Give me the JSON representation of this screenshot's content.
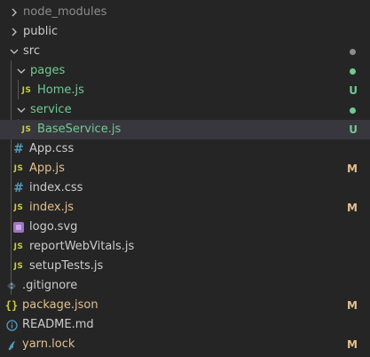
{
  "colors": {
    "background": "#252526",
    "selected_row": "#37373d",
    "default_text": "#cccccc",
    "ignored_text": "#8c8c8c",
    "untracked": "#73c991",
    "modified": "#e2c08d",
    "dot_gray": "#8c8c8c",
    "dot_green": "#73c991",
    "js_icon": "#cbcb41",
    "css_icon": "#519aba"
  },
  "tree": [
    {
      "name": "node_modules",
      "kind": "folder",
      "expanded": false,
      "status": "ignored",
      "icon": "chevron-right-icon"
    },
    {
      "name": "public",
      "kind": "folder",
      "expanded": false,
      "status": "normal",
      "icon": "chevron-right-icon"
    },
    {
      "name": "src",
      "kind": "folder",
      "expanded": true,
      "status": "normal",
      "icon": "chevron-down-icon",
      "dot": "gray"
    },
    {
      "name": "pages",
      "kind": "folder",
      "expanded": true,
      "status": "untracked",
      "icon": "chevron-down-icon",
      "dot": "green"
    },
    {
      "name": "Home.js",
      "kind": "file",
      "status": "untracked",
      "icon": "js-icon",
      "icon_text": "JS",
      "badge": "U"
    },
    {
      "name": "service",
      "kind": "folder",
      "expanded": true,
      "status": "untracked",
      "icon": "chevron-down-icon",
      "dot": "green"
    },
    {
      "name": "BaseService.js",
      "kind": "file",
      "status": "untracked",
      "icon": "js-icon",
      "icon_text": "JS",
      "badge": "U",
      "selected": true
    },
    {
      "name": "App.css",
      "kind": "file",
      "status": "normal",
      "icon": "css-icon",
      "icon_text": "#"
    },
    {
      "name": "App.js",
      "kind": "file",
      "status": "modified",
      "icon": "js-icon",
      "icon_text": "JS",
      "badge": "M"
    },
    {
      "name": "index.css",
      "kind": "file",
      "status": "normal",
      "icon": "css-icon",
      "icon_text": "#"
    },
    {
      "name": "index.js",
      "kind": "file",
      "status": "modified",
      "icon": "js-icon",
      "icon_text": "JS",
      "badge": "M"
    },
    {
      "name": "logo.svg",
      "kind": "file",
      "status": "normal",
      "icon": "svg-icon"
    },
    {
      "name": "reportWebVitals.js",
      "kind": "file",
      "status": "normal",
      "icon": "js-icon",
      "icon_text": "JS"
    },
    {
      "name": "setupTests.js",
      "kind": "file",
      "status": "normal",
      "icon": "js-icon",
      "icon_text": "JS"
    },
    {
      "name": ".gitignore",
      "kind": "file",
      "status": "normal",
      "icon": "git-icon"
    },
    {
      "name": "package.json",
      "kind": "file",
      "status": "modified",
      "icon": "json-icon",
      "icon_text": "{}",
      "badge": "M"
    },
    {
      "name": "README.md",
      "kind": "file",
      "status": "normal",
      "icon": "info-icon"
    },
    {
      "name": "yarn.lock",
      "kind": "file",
      "status": "modified",
      "icon": "yarn-icon",
      "badge": "M"
    }
  ]
}
